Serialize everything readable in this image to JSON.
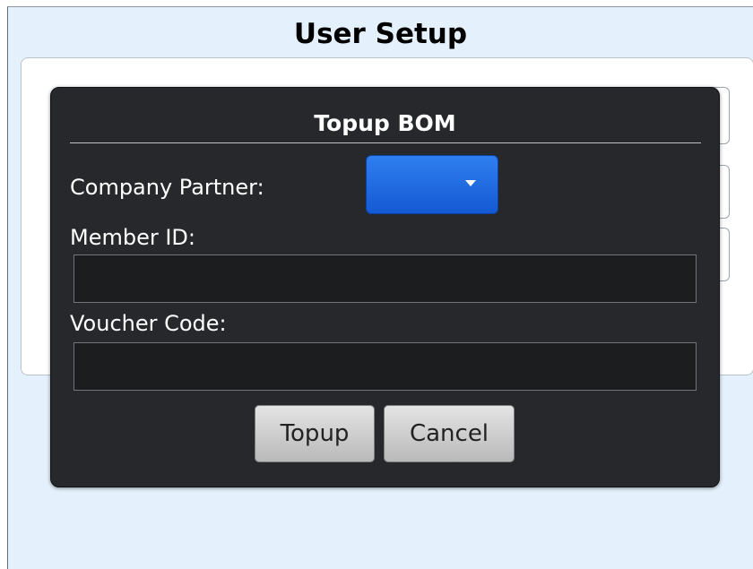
{
  "window": {
    "title": "User Setup"
  },
  "dialog": {
    "title": "Topup BOM",
    "fields": {
      "company_partner_label": "Company Partner:",
      "company_partner_value": "",
      "member_id_label": "Member ID:",
      "member_id_value": "",
      "voucher_code_label": "Voucher Code:",
      "voucher_code_value": ""
    },
    "buttons": {
      "topup_label": "Topup",
      "cancel_label": "Cancel"
    }
  },
  "colors": {
    "window_background": "#e4f1fc",
    "dialog_background": "#26282b",
    "dropdown_accent": "#1f6be0",
    "button_background": "#d0d0d0"
  },
  "icons": {
    "dropdown_arrow": "chevron-down-icon"
  }
}
